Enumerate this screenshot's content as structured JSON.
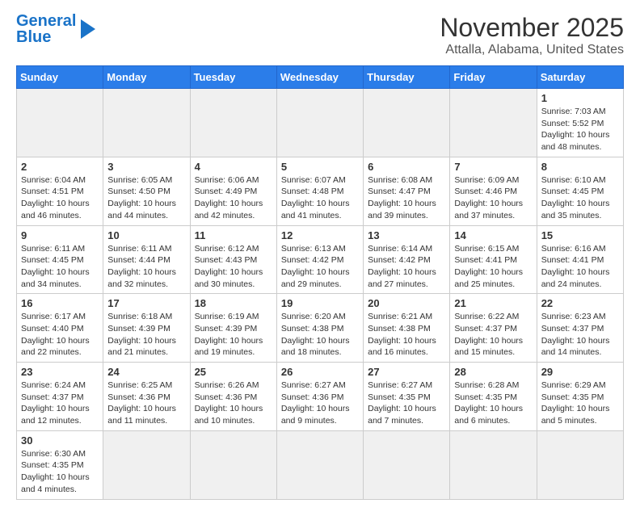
{
  "logo": {
    "text_general": "General",
    "text_blue": "Blue"
  },
  "title": "November 2025",
  "subtitle": "Attalla, Alabama, United States",
  "weekdays": [
    "Sunday",
    "Monday",
    "Tuesday",
    "Wednesday",
    "Thursday",
    "Friday",
    "Saturday"
  ],
  "weeks": [
    [
      {
        "day": "",
        "info": "",
        "gray": true
      },
      {
        "day": "",
        "info": "",
        "gray": true
      },
      {
        "day": "",
        "info": "",
        "gray": true
      },
      {
        "day": "",
        "info": "",
        "gray": true
      },
      {
        "day": "",
        "info": "",
        "gray": true
      },
      {
        "day": "",
        "info": "",
        "gray": true
      },
      {
        "day": "1",
        "info": "Sunrise: 7:03 AM\nSunset: 5:52 PM\nDaylight: 10 hours\nand 48 minutes.",
        "gray": false
      }
    ],
    [
      {
        "day": "2",
        "info": "Sunrise: 6:04 AM\nSunset: 4:51 PM\nDaylight: 10 hours\nand 46 minutes.",
        "gray": false
      },
      {
        "day": "3",
        "info": "Sunrise: 6:05 AM\nSunset: 4:50 PM\nDaylight: 10 hours\nand 44 minutes.",
        "gray": false
      },
      {
        "day": "4",
        "info": "Sunrise: 6:06 AM\nSunset: 4:49 PM\nDaylight: 10 hours\nand 42 minutes.",
        "gray": false
      },
      {
        "day": "5",
        "info": "Sunrise: 6:07 AM\nSunset: 4:48 PM\nDaylight: 10 hours\nand 41 minutes.",
        "gray": false
      },
      {
        "day": "6",
        "info": "Sunrise: 6:08 AM\nSunset: 4:47 PM\nDaylight: 10 hours\nand 39 minutes.",
        "gray": false
      },
      {
        "day": "7",
        "info": "Sunrise: 6:09 AM\nSunset: 4:46 PM\nDaylight: 10 hours\nand 37 minutes.",
        "gray": false
      },
      {
        "day": "8",
        "info": "Sunrise: 6:10 AM\nSunset: 4:45 PM\nDaylight: 10 hours\nand 35 minutes.",
        "gray": false
      }
    ],
    [
      {
        "day": "9",
        "info": "Sunrise: 6:11 AM\nSunset: 4:45 PM\nDaylight: 10 hours\nand 34 minutes.",
        "gray": false
      },
      {
        "day": "10",
        "info": "Sunrise: 6:11 AM\nSunset: 4:44 PM\nDaylight: 10 hours\nand 32 minutes.",
        "gray": false
      },
      {
        "day": "11",
        "info": "Sunrise: 6:12 AM\nSunset: 4:43 PM\nDaylight: 10 hours\nand 30 minutes.",
        "gray": false
      },
      {
        "day": "12",
        "info": "Sunrise: 6:13 AM\nSunset: 4:42 PM\nDaylight: 10 hours\nand 29 minutes.",
        "gray": false
      },
      {
        "day": "13",
        "info": "Sunrise: 6:14 AM\nSunset: 4:42 PM\nDaylight: 10 hours\nand 27 minutes.",
        "gray": false
      },
      {
        "day": "14",
        "info": "Sunrise: 6:15 AM\nSunset: 4:41 PM\nDaylight: 10 hours\nand 25 minutes.",
        "gray": false
      },
      {
        "day": "15",
        "info": "Sunrise: 6:16 AM\nSunset: 4:41 PM\nDaylight: 10 hours\nand 24 minutes.",
        "gray": false
      }
    ],
    [
      {
        "day": "16",
        "info": "Sunrise: 6:17 AM\nSunset: 4:40 PM\nDaylight: 10 hours\nand 22 minutes.",
        "gray": false
      },
      {
        "day": "17",
        "info": "Sunrise: 6:18 AM\nSunset: 4:39 PM\nDaylight: 10 hours\nand 21 minutes.",
        "gray": false
      },
      {
        "day": "18",
        "info": "Sunrise: 6:19 AM\nSunset: 4:39 PM\nDaylight: 10 hours\nand 19 minutes.",
        "gray": false
      },
      {
        "day": "19",
        "info": "Sunrise: 6:20 AM\nSunset: 4:38 PM\nDaylight: 10 hours\nand 18 minutes.",
        "gray": false
      },
      {
        "day": "20",
        "info": "Sunrise: 6:21 AM\nSunset: 4:38 PM\nDaylight: 10 hours\nand 16 minutes.",
        "gray": false
      },
      {
        "day": "21",
        "info": "Sunrise: 6:22 AM\nSunset: 4:37 PM\nDaylight: 10 hours\nand 15 minutes.",
        "gray": false
      },
      {
        "day": "22",
        "info": "Sunrise: 6:23 AM\nSunset: 4:37 PM\nDaylight: 10 hours\nand 14 minutes.",
        "gray": false
      }
    ],
    [
      {
        "day": "23",
        "info": "Sunrise: 6:24 AM\nSunset: 4:37 PM\nDaylight: 10 hours\nand 12 minutes.",
        "gray": false
      },
      {
        "day": "24",
        "info": "Sunrise: 6:25 AM\nSunset: 4:36 PM\nDaylight: 10 hours\nand 11 minutes.",
        "gray": false
      },
      {
        "day": "25",
        "info": "Sunrise: 6:26 AM\nSunset: 4:36 PM\nDaylight: 10 hours\nand 10 minutes.",
        "gray": false
      },
      {
        "day": "26",
        "info": "Sunrise: 6:27 AM\nSunset: 4:36 PM\nDaylight: 10 hours\nand 9 minutes.",
        "gray": false
      },
      {
        "day": "27",
        "info": "Sunrise: 6:27 AM\nSunset: 4:35 PM\nDaylight: 10 hours\nand 7 minutes.",
        "gray": false
      },
      {
        "day": "28",
        "info": "Sunrise: 6:28 AM\nSunset: 4:35 PM\nDaylight: 10 hours\nand 6 minutes.",
        "gray": false
      },
      {
        "day": "29",
        "info": "Sunrise: 6:29 AM\nSunset: 4:35 PM\nDaylight: 10 hours\nand 5 minutes.",
        "gray": false
      }
    ],
    [
      {
        "day": "30",
        "info": "Sunrise: 6:30 AM\nSunset: 4:35 PM\nDaylight: 10 hours\nand 4 minutes.",
        "gray": false
      },
      {
        "day": "",
        "info": "",
        "gray": true
      },
      {
        "day": "",
        "info": "",
        "gray": true
      },
      {
        "day": "",
        "info": "",
        "gray": true
      },
      {
        "day": "",
        "info": "",
        "gray": true
      },
      {
        "day": "",
        "info": "",
        "gray": true
      },
      {
        "day": "",
        "info": "",
        "gray": true
      }
    ]
  ]
}
